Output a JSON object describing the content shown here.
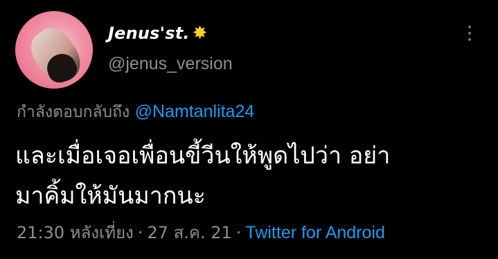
{
  "tweet": {
    "display_name": "Jenus'st.",
    "handle": "@jenus_version",
    "reply_prefix": "กำลังตอบกลับถึง",
    "reply_to": "@Namtanlita24",
    "text_line_1": "และเมื่อเจอเพื่อนขี้วีนให้พูดไปว่า อย่า",
    "text_line_2": "มาคิ้มให้มันมากนะ",
    "time": "21:30 หลังเที่ยง",
    "separator": "·",
    "date": "27 ส.ค. 21",
    "source": "Twitter for Android"
  },
  "icons": {
    "name_emoji": "sparkle-icon",
    "menu": "more-icon"
  },
  "colors": {
    "background": "#000000",
    "accent": "#1d9bf0",
    "secondary_text": "#8b8f94",
    "primary_text": "#ffffff"
  },
  "glyphs": {
    "sparkle": "✸"
  }
}
